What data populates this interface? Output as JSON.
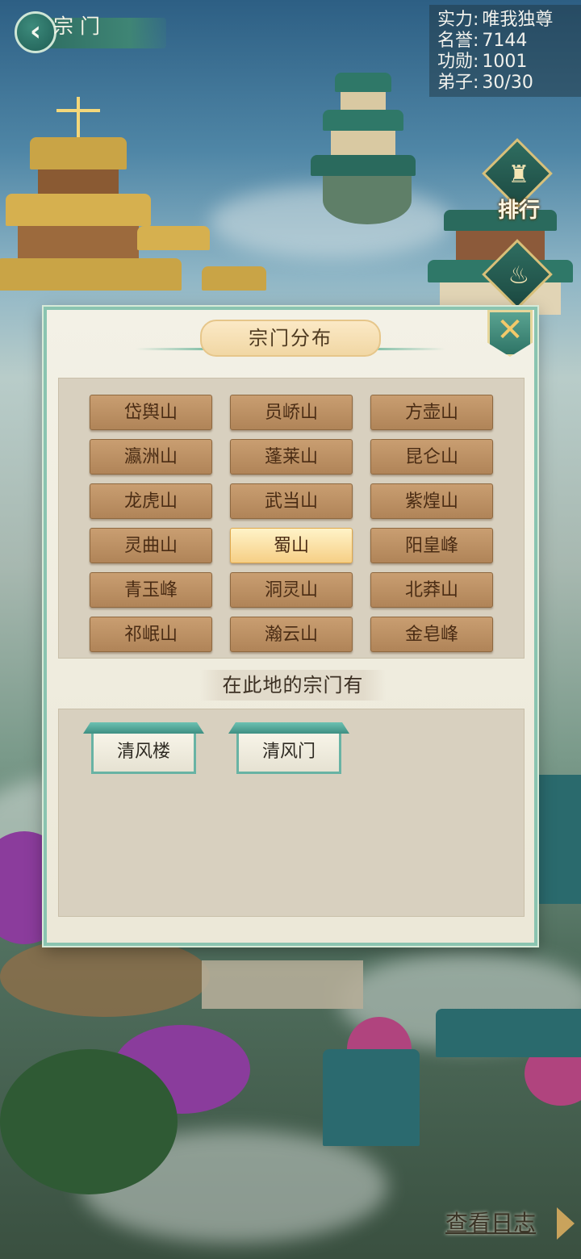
{
  "header": {
    "title": "宗门",
    "back_label": "‹"
  },
  "stats": [
    {
      "label": "实力:",
      "value": "唯我独尊"
    },
    {
      "label": "名誉:",
      "value": "7144"
    },
    {
      "label": "功勋:",
      "value": "1001"
    },
    {
      "label": "弟子:",
      "value": "30/30"
    }
  ],
  "side_buttons": [
    {
      "label": "排行",
      "icon": "banner-icon"
    },
    {
      "label": "",
      "icon": "flame-emblem-icon"
    }
  ],
  "dialog": {
    "title": "宗门分布",
    "close_label": "✕",
    "mountains": [
      "岱舆山",
      "员峤山",
      "方壶山",
      "瀛洲山",
      "蓬莱山",
      "昆仑山",
      "龙虎山",
      "武当山",
      "紫煌山",
      "灵曲山",
      "蜀山",
      "阳皇峰",
      "青玉峰",
      "洞灵山",
      "北莽山",
      "祁岷山",
      "瀚云山",
      "金皂峰"
    ],
    "selected_mountain": "蜀山",
    "sects_header": "在此地的宗门有",
    "sects": [
      "清风楼",
      "清风门"
    ]
  },
  "footer": {
    "log_link": "查看日志"
  },
  "colors": {
    "accent": "#3f8575",
    "selected": "#f6cf86",
    "button": "#b08458"
  }
}
